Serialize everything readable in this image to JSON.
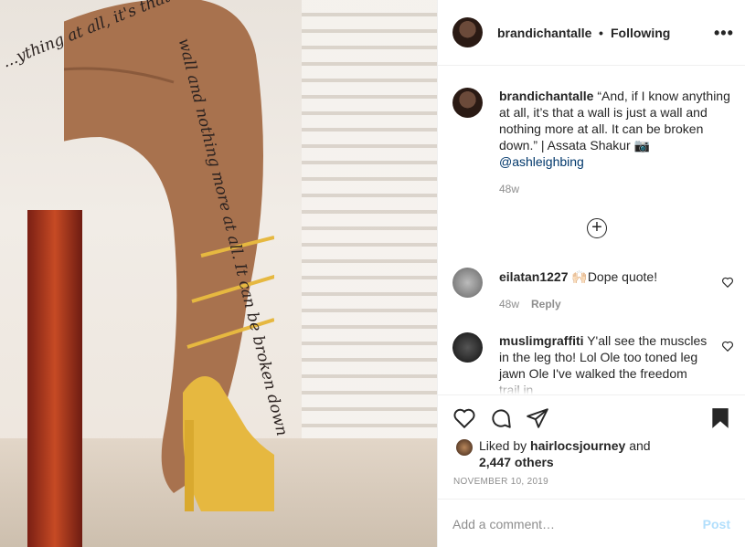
{
  "post": {
    "username": "brandichantalle",
    "dot": "•",
    "following_label": "Following",
    "more_label": "•••",
    "caption_username": "brandichantalle",
    "caption_text": "“And, if I know anything at all, it’s that a wall is just a wall and nothing more at all. It can be broken down.” | Assata Shakur 📷",
    "caption_mention": "@ashleighbing",
    "caption_time": "48w",
    "plus_label": "+"
  },
  "photo": {
    "tattoo_line1": "...ything at all, it's that a wall is just a",
    "tattoo_line2": "wall and nothing more at all. It can be broken down"
  },
  "comments": [
    {
      "username": "eilatan1227",
      "text": "🙌🏻Dope quote!",
      "time": "48w",
      "reply_label": "Reply"
    },
    {
      "username": "muslimgraffiti",
      "text": "Y'all see the muscles in the leg tho! Lol Ole too toned leg jawn Ole I've walked the freedom trail in"
    }
  ],
  "actions": {
    "icons": [
      "heart-icon",
      "comment-icon",
      "share-icon",
      "bookmark-icon"
    ],
    "liked_by_prefix": "Liked by",
    "liked_by_user": "hairlocsjourney",
    "liked_by_and": "and",
    "liked_count": "2,447 others",
    "date": "NOVEMBER 10, 2019"
  },
  "add_comment": {
    "placeholder": "Add a comment…",
    "post_label": "Post"
  },
  "colors": {
    "link": "#00376b",
    "muted": "#8e8e8e",
    "post_disabled": "#b2dffc",
    "text": "#262626"
  }
}
